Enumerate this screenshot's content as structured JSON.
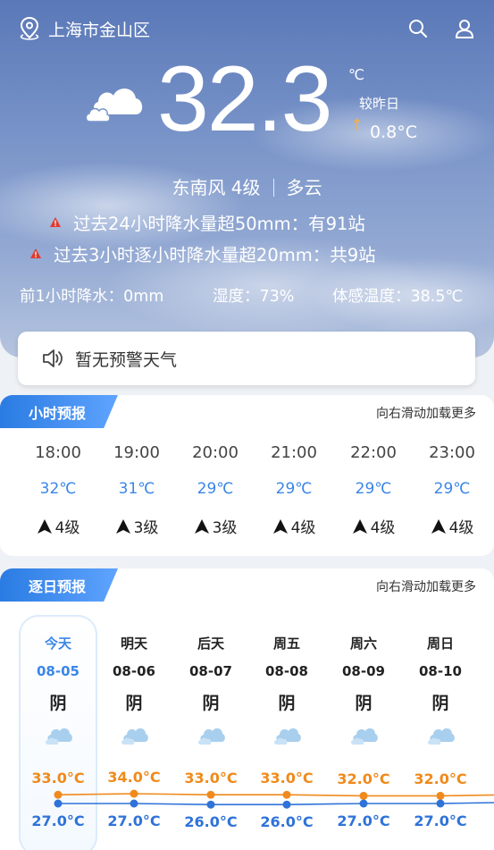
{
  "header": {
    "location": "上海市金山区",
    "icons": [
      "location-pin-icon",
      "search-icon",
      "user-icon"
    ]
  },
  "current": {
    "temperature": "32.3",
    "unit": "℃",
    "compare_label": "较昨日",
    "compare_arrow": "↑",
    "compare_value": "0.8°C",
    "wind": "东南风 4级",
    "condition": "多云"
  },
  "alerts": [
    "过去24小时降水量超50mm：有91站",
    "过去3小时逐小时降水量超20mm：共9站"
  ],
  "stats": {
    "precip": "前1小时降水：0mm",
    "humidity": "湿度：73%",
    "feels_like": "体感温度：38.5℃"
  },
  "warning": {
    "text": "暂无预警天气"
  },
  "hourly": {
    "title": "小时预报",
    "more": "向右滑动加载更多",
    "items": [
      {
        "time": "18:00",
        "temp": "32℃",
        "wind": "4级"
      },
      {
        "time": "19:00",
        "temp": "31℃",
        "wind": "3级"
      },
      {
        "time": "20:00",
        "temp": "29℃",
        "wind": "3级"
      },
      {
        "time": "21:00",
        "temp": "29℃",
        "wind": "4级"
      },
      {
        "time": "22:00",
        "temp": "29℃",
        "wind": "4级"
      },
      {
        "time": "23:00",
        "temp": "29℃",
        "wind": "4级"
      }
    ]
  },
  "daily": {
    "title": "逐日预报",
    "more": "向右滑动加载更多",
    "items": [
      {
        "day": "今天",
        "date": "08-05",
        "cond": "阴",
        "high": "33.0°C",
        "low": "27.0°C",
        "high_val": 33.0,
        "low_val": 27.0
      },
      {
        "day": "明天",
        "date": "08-06",
        "cond": "阴",
        "high": "34.0°C",
        "low": "27.0°C",
        "high_val": 34.0,
        "low_val": 27.0
      },
      {
        "day": "后天",
        "date": "08-07",
        "cond": "阴",
        "high": "33.0°C",
        "low": "26.0°C",
        "high_val": 33.0,
        "low_val": 26.0
      },
      {
        "day": "周五",
        "date": "08-08",
        "cond": "阴",
        "high": "33.0°C",
        "low": "26.0°C",
        "high_val": 33.0,
        "low_val": 26.0
      },
      {
        "day": "周六",
        "date": "08-09",
        "cond": "阴",
        "high": "32.0°C",
        "low": "27.0°C",
        "high_val": 32.0,
        "low_val": 27.0
      },
      {
        "day": "周日",
        "date": "08-10",
        "cond": "阴",
        "high": "32.0°C",
        "low": "27.0°C",
        "high_val": 32.0,
        "low_val": 27.0
      }
    ]
  },
  "colors": {
    "accent": "#3a86e8",
    "high_temp": "#f08a1c",
    "low_temp": "#2f73d8"
  }
}
